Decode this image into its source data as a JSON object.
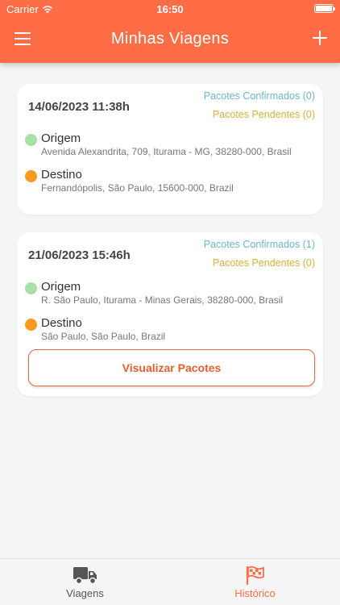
{
  "status_bar": {
    "carrier": "Carrier",
    "time": "16:50"
  },
  "header": {
    "title": "Minhas Viagens",
    "menu_icon": "hamburger-menu-icon",
    "add_icon": "plus-icon"
  },
  "trips": [
    {
      "date": "14/06/2023 11:38h",
      "confirmed": "Pacotes Confirmados (0)",
      "pending": "Pacotes Pendentes (0)",
      "origin_label": "Origem",
      "origin_address": "Avenida Alexandrita, 709, Iturama - MG, 38280-000, Brasil",
      "destination_label": "Destino",
      "destination_address": "Fernandópolis,  São Paulo, 15600-000, Brazil"
    },
    {
      "date": "21/06/2023 15:46h",
      "confirmed": "Pacotes Confirmados (1)",
      "pending": "Pacotes Pendentes (0)",
      "origin_label": "Origem",
      "origin_address": "R. São Paulo, Iturama - Minas Gerais, 38280-000, Brasil",
      "destination_label": "Destino",
      "destination_address": "São Paulo,  São Paulo, Brazil",
      "button_label": "Visualizar Pacotes"
    }
  ],
  "tab_bar": {
    "tabs": [
      {
        "label": "Viagens",
        "icon": "truck-icon",
        "active": false
      },
      {
        "label": "Histórico",
        "icon": "checkered-flag-icon",
        "active": true
      }
    ]
  },
  "colors": {
    "primary": "#fe6d45",
    "confirmed": "#6eb7c9",
    "pending": "#d7b33c",
    "origin_dot": "#a7e0a3",
    "destination_dot": "#f99a1c"
  }
}
